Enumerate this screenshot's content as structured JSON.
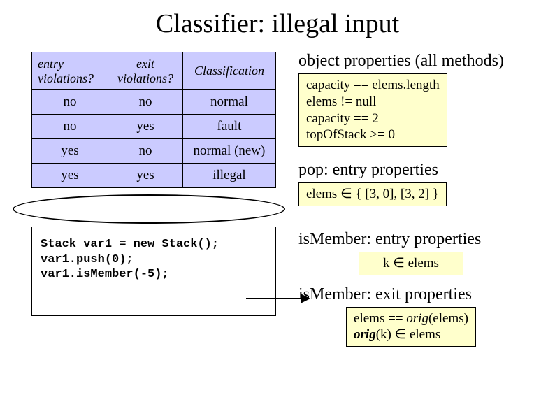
{
  "title": "Classifier: illegal input",
  "table": {
    "headers": {
      "col1_a": "entry",
      "col1_b": "violations?",
      "col2_a": "exit",
      "col2_b": "violations?",
      "col3": "Classification"
    },
    "rows": [
      {
        "c1": "no",
        "c2": "no",
        "c3": "normal"
      },
      {
        "c1": "no",
        "c2": "yes",
        "c3": "fault"
      },
      {
        "c1": "yes",
        "c2": "no",
        "c3": "normal (new)"
      },
      {
        "c1": "yes",
        "c2": "yes",
        "c3": "illegal"
      }
    ]
  },
  "code": {
    "line1": "Stack var1 = new Stack();",
    "line2": "var1.push(0);",
    "line3": "var1.isMember(-5);"
  },
  "right": {
    "obj_head": "object properties (all methods)",
    "obj_props": {
      "l1": "capacity == elems.length",
      "l2": "elems != null",
      "l3": "capacity == 2",
      "l4": "topOfStack >= 0"
    },
    "pop_head": "pop: entry properties",
    "pop_props": "elems ∈ { [3, 0], [3, 2] }",
    "ism_entry_head": "isMember: entry properties",
    "ism_entry_props": {
      "pre": "k ",
      "in": "∈",
      "post": " elems"
    },
    "ism_exit_head": "isMember: exit properties",
    "ism_exit_props": {
      "l1_a": "elems == ",
      "l1_orig": "orig",
      "l1_b": "(elems)",
      "l2_orig": "orig",
      "l2_a": "(k) ",
      "l2_in": "∈",
      "l2_b": " elems"
    }
  }
}
